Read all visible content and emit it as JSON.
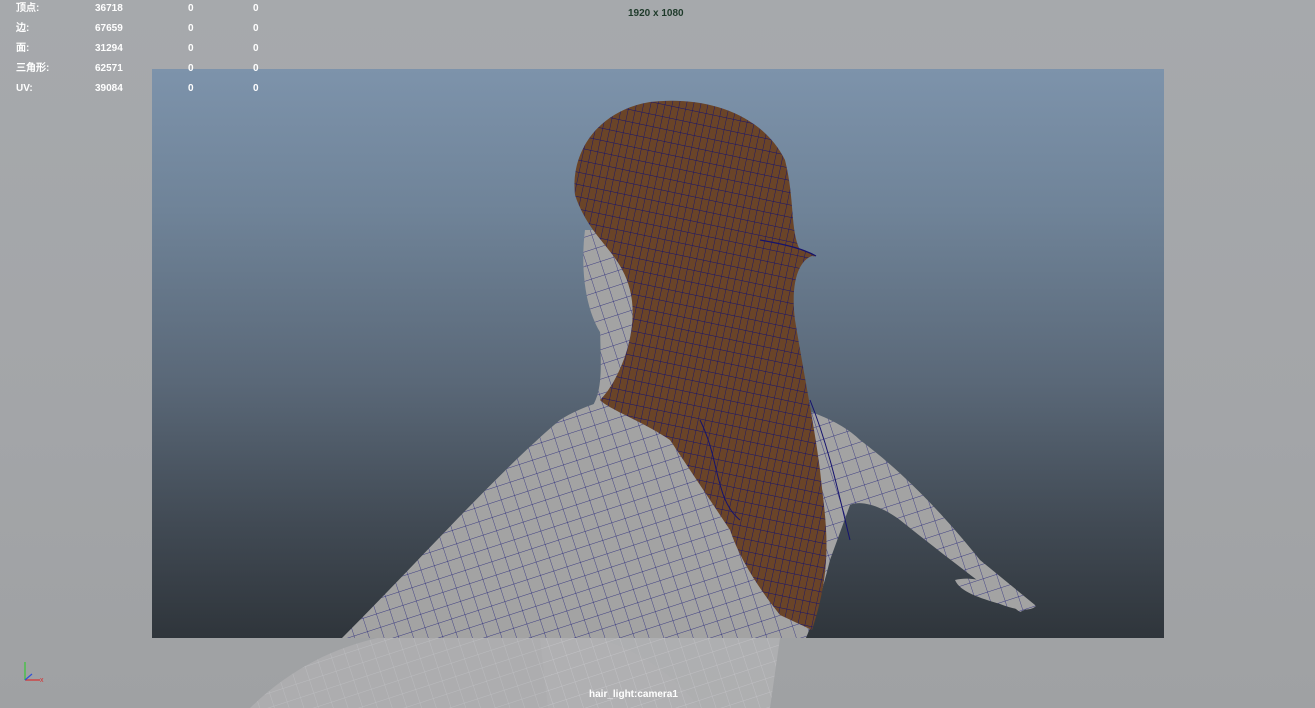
{
  "stats": {
    "rows": [
      {
        "label": "顶点:",
        "v1": "36718",
        "v2": "0",
        "v3": "0"
      },
      {
        "label": "边:",
        "v1": "67659",
        "v2": "0",
        "v3": "0"
      },
      {
        "label": "面:",
        "v1": "31294",
        "v2": "0",
        "v3": "0"
      },
      {
        "label": "三角形:",
        "v1": "62571",
        "v2": "0",
        "v3": "0"
      },
      {
        "label": "UV:",
        "v1": "39084",
        "v2": "0",
        "v3": "0"
      }
    ]
  },
  "viewport": {
    "resolution": "1920 x 1080",
    "camera": "hair_light:camera1"
  },
  "colors": {
    "wireframe": "#1a1a7a",
    "skin": "#9a9a9a",
    "hair": "#5a3a24",
    "gate_top": "#7d93ab",
    "gate_bottom": "#2f353b"
  },
  "axis": {
    "x_label": "x",
    "y_label": "y",
    "z_label": "z"
  }
}
